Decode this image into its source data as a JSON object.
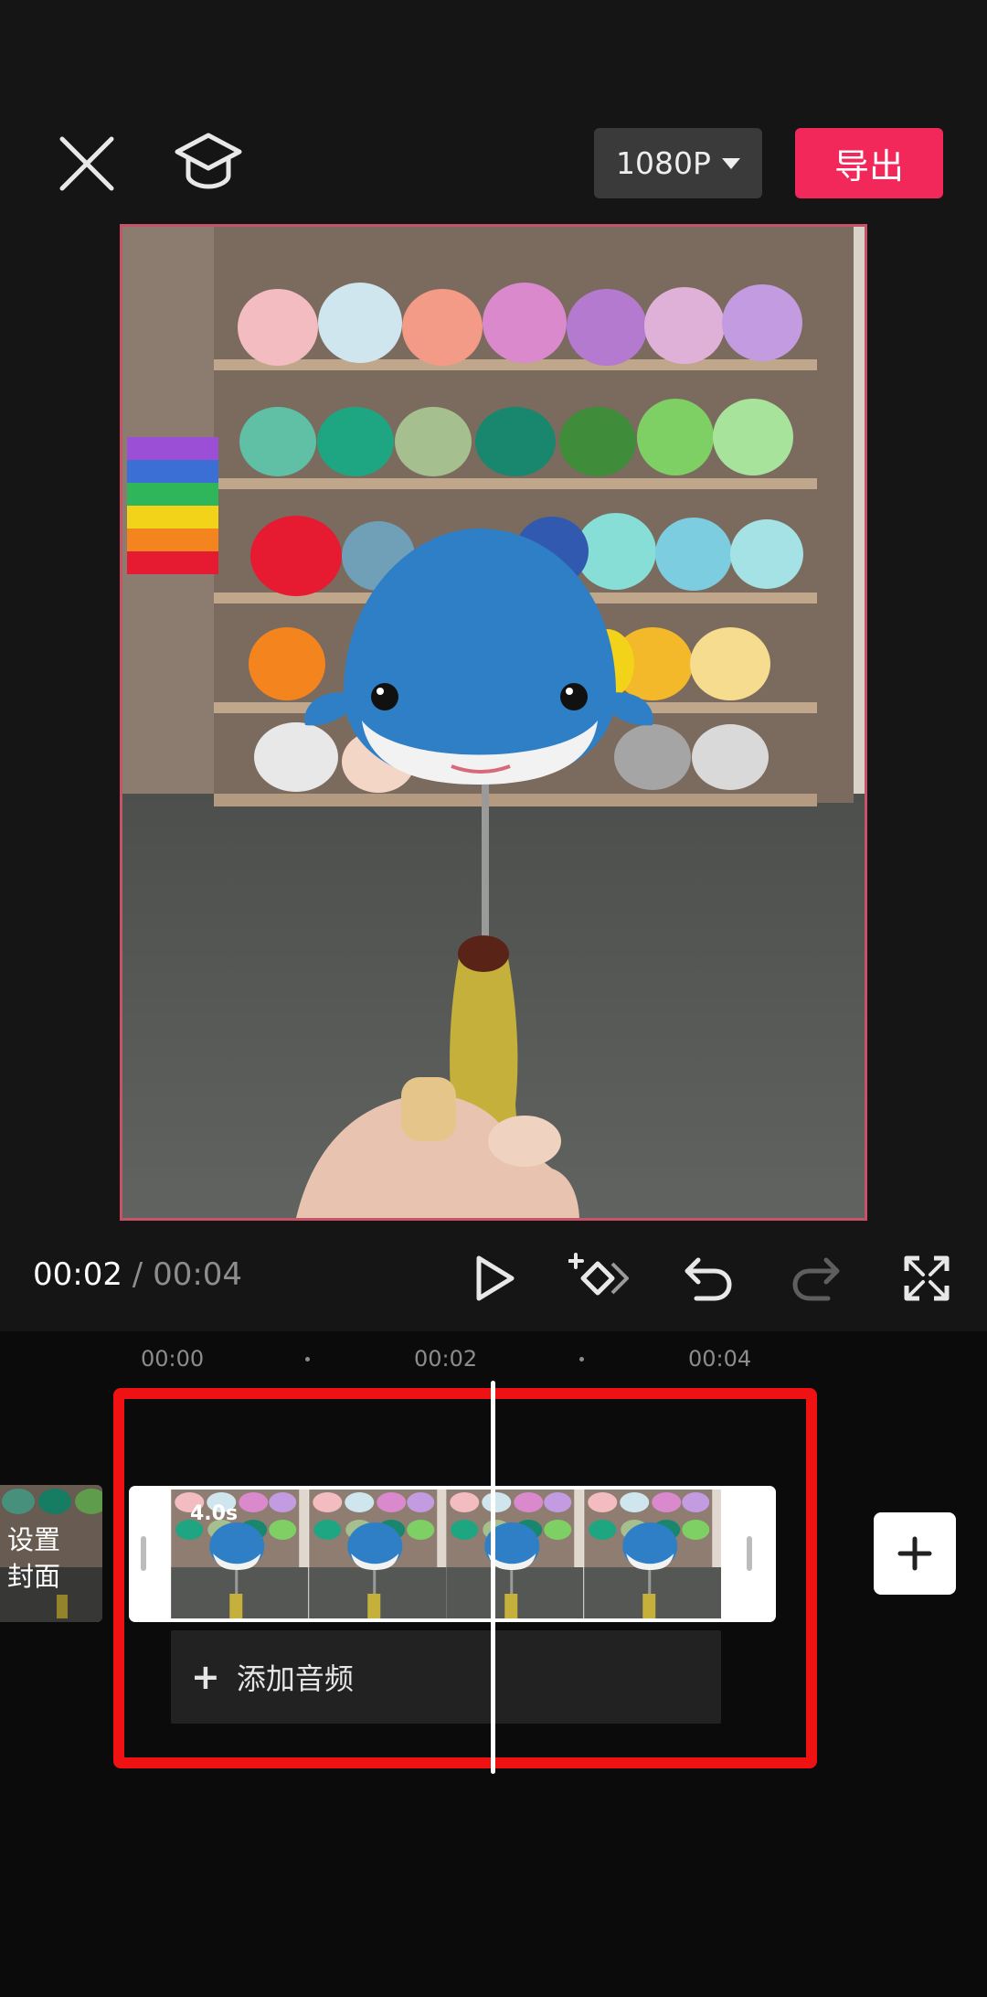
{
  "topbar": {
    "close_icon": "close-icon",
    "tutorial_icon": "graduation-cap-icon",
    "resolution_label": "1080P",
    "export_label": "导出",
    "export_color": "#f3285a"
  },
  "player": {
    "current_time": "00:02",
    "separator": "/",
    "total_time": "00:04",
    "icons": [
      "play-icon",
      "keyframe-icon",
      "undo-icon",
      "redo-icon",
      "fullscreen-icon"
    ]
  },
  "timeline": {
    "ticks": [
      "00:00",
      "00:02",
      "00:04"
    ],
    "cover_label": "设置\n封面",
    "clip_duration": "4.0s",
    "add_audio_label": "添加音频",
    "add_audio_icon": "plus-icon",
    "add_clip_icon": "plus-icon",
    "highlight_color": "#f01212"
  }
}
